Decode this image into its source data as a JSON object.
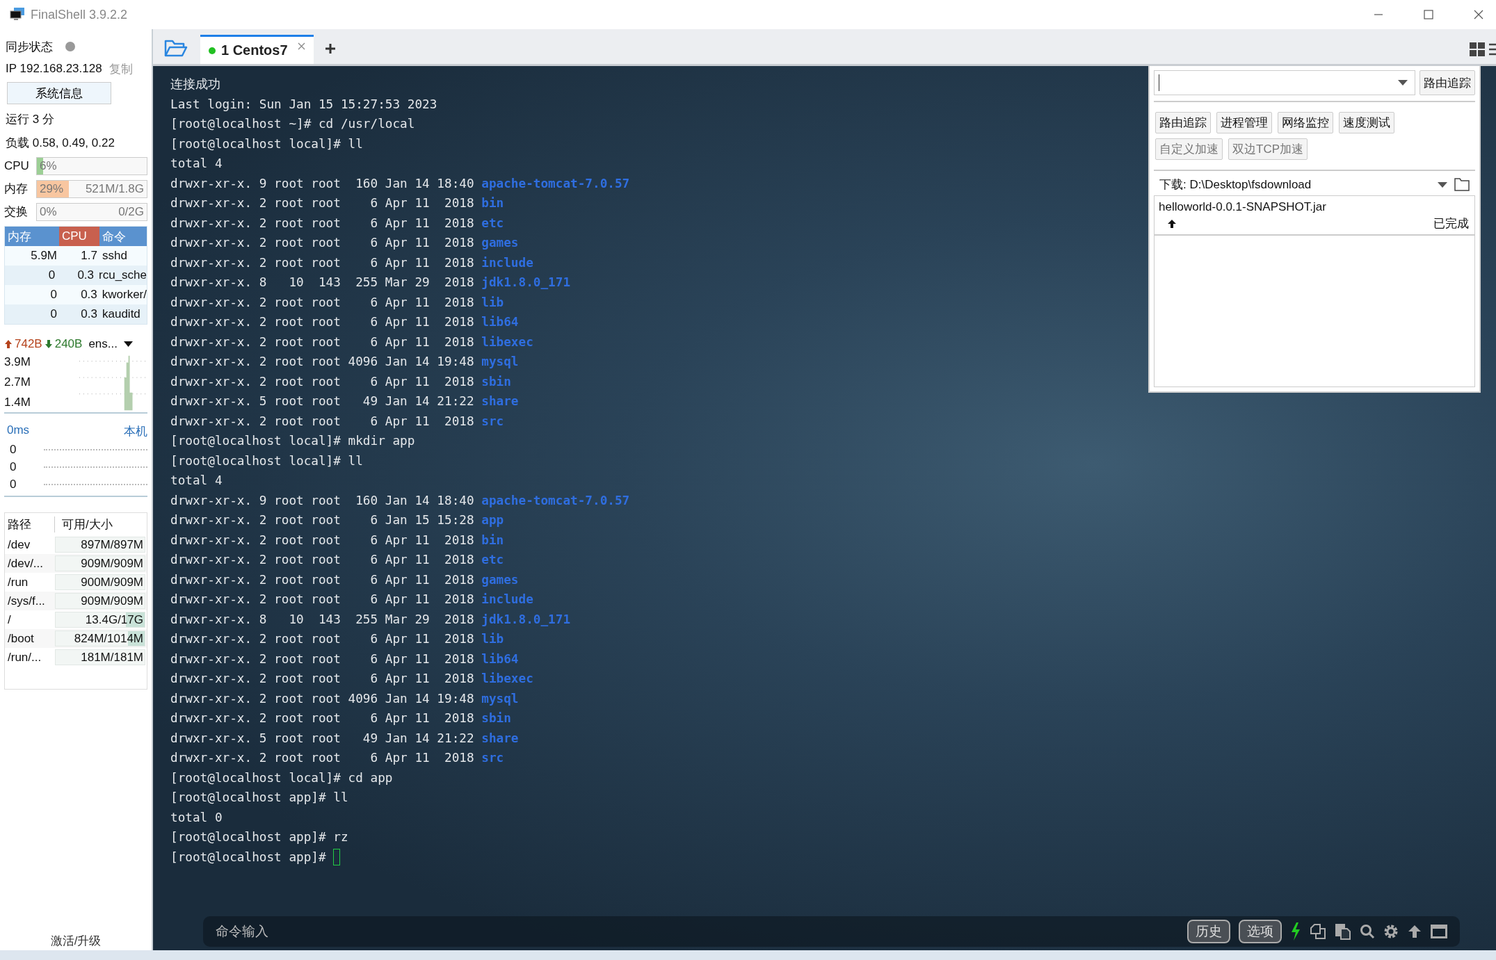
{
  "window": {
    "title": "FinalShell 3.9.2.2"
  },
  "sidebar": {
    "sync": {
      "label": "同步状态",
      "online": false
    },
    "ip": {
      "text": "IP 192.168.23.128",
      "copy": "复制"
    },
    "sysinfo_button": "系统信息",
    "uptime": "运行 3 分",
    "load": "负载 0.58, 0.49, 0.22",
    "meters": [
      {
        "label": "CPU",
        "reading": "6%",
        "level": 0.06,
        "color": "#9ccf95"
      },
      {
        "label": "内存",
        "reading": "29%",
        "detail": "521M/1.8G",
        "level": 0.29,
        "color": "#f8c6a0"
      },
      {
        "label": "交换",
        "reading": "0%",
        "detail": "0/2G",
        "level": 0
      }
    ],
    "processes": {
      "columns": [
        {
          "label": "内存",
          "selected": false
        },
        {
          "label": "CPU",
          "selected": true
        },
        {
          "label": "命令",
          "selected": false
        }
      ],
      "rows": [
        [
          "5.9M",
          "1.7",
          "sshd"
        ],
        [
          "0",
          "0.3",
          "rcu_sche"
        ],
        [
          "0",
          "0.3",
          "kworker/"
        ],
        [
          "0",
          "0.3",
          "kauditd"
        ]
      ]
    },
    "network": {
      "up": "742B",
      "down": "240B",
      "interface": "ens...",
      "scale": [
        "3.9M",
        "2.7M",
        "1.4M"
      ]
    },
    "ping": {
      "latency": "0ms",
      "host": "本机",
      "values": [
        "0",
        "0",
        "0"
      ]
    },
    "disks": {
      "columns": [
        "路径",
        "可用/大小"
      ],
      "rows": [
        {
          "path": "/dev",
          "usage": "897M/897M"
        },
        {
          "path": "/dev/...",
          "usage": "909M/909M"
        },
        {
          "path": "/run",
          "usage": "900M/909M"
        },
        {
          "path": "/sys/f...",
          "usage": "909M/909M"
        },
        {
          "path": "/",
          "usage": "13.4G/17G",
          "level": 0.21
        },
        {
          "path": "/boot",
          "usage": "824M/1014M",
          "level": 0.19
        },
        {
          "path": "/run/...",
          "usage": "181M/181M"
        }
      ]
    },
    "upgrade_link": "激活/升级"
  },
  "tabs": [
    {
      "label": "1 Centos7",
      "selected": true,
      "connected": true
    }
  ],
  "terminal": {
    "lines": [
      {
        "kind": "text",
        "text": "连接成功"
      },
      {
        "kind": "text",
        "text": "Last login: Sun Jan 15 15:27:53 2023"
      },
      {
        "kind": "text",
        "text": "[root@localhost ~]# cd /usr/local"
      },
      {
        "kind": "text",
        "text": "[root@localhost local]# ll"
      },
      {
        "kind": "text",
        "text": "total 4"
      },
      {
        "kind": "entry",
        "text": "drwxr-xr-x. 9 root root  160 Jan 14 18:40",
        "name": "apache-tomcat-7.0.57"
      },
      {
        "kind": "entry",
        "text": "drwxr-xr-x. 2 root root    6 Apr 11  2018",
        "name": "bin"
      },
      {
        "kind": "entry",
        "text": "drwxr-xr-x. 2 root root    6 Apr 11  2018",
        "name": "etc"
      },
      {
        "kind": "entry",
        "text": "drwxr-xr-x. 2 root root    6 Apr 11  2018",
        "name": "games"
      },
      {
        "kind": "entry",
        "text": "drwxr-xr-x. 2 root root    6 Apr 11  2018",
        "name": "include"
      },
      {
        "kind": "entry",
        "text": "drwxr-xr-x. 8   10  143  255 Mar 29  2018",
        "name": "jdk1.8.0_171"
      },
      {
        "kind": "entry",
        "text": "drwxr-xr-x. 2 root root    6 Apr 11  2018",
        "name": "lib"
      },
      {
        "kind": "entry",
        "text": "drwxr-xr-x. 2 root root    6 Apr 11  2018",
        "name": "lib64"
      },
      {
        "kind": "entry",
        "text": "drwxr-xr-x. 2 root root    6 Apr 11  2018",
        "name": "libexec"
      },
      {
        "kind": "entry",
        "text": "drwxr-xr-x. 2 root root 4096 Jan 14 19:48",
        "name": "mysql"
      },
      {
        "kind": "entry",
        "text": "drwxr-xr-x. 2 root root    6 Apr 11  2018",
        "name": "sbin"
      },
      {
        "kind": "entry",
        "text": "drwxr-xr-x. 5 root root   49 Jan 14 21:22",
        "name": "share"
      },
      {
        "kind": "entry",
        "text": "drwxr-xr-x. 2 root root    6 Apr 11  2018",
        "name": "src"
      },
      {
        "kind": "text",
        "text": "[root@localhost local]# mkdir app"
      },
      {
        "kind": "text",
        "text": "[root@localhost local]# ll"
      },
      {
        "kind": "text",
        "text": "total 4"
      },
      {
        "kind": "entry",
        "text": "drwxr-xr-x. 9 root root  160 Jan 14 18:40",
        "name": "apache-tomcat-7.0.57"
      },
      {
        "kind": "entry",
        "text": "drwxr-xr-x. 2 root root    6 Jan 15 15:28",
        "name": "app"
      },
      {
        "kind": "entry",
        "text": "drwxr-xr-x. 2 root root    6 Apr 11  2018",
        "name": "bin"
      },
      {
        "kind": "entry",
        "text": "drwxr-xr-x. 2 root root    6 Apr 11  2018",
        "name": "etc"
      },
      {
        "kind": "entry",
        "text": "drwxr-xr-x. 2 root root    6 Apr 11  2018",
        "name": "games"
      },
      {
        "kind": "entry",
        "text": "drwxr-xr-x. 2 root root    6 Apr 11  2018",
        "name": "include"
      },
      {
        "kind": "entry",
        "text": "drwxr-xr-x. 8   10  143  255 Mar 29  2018",
        "name": "jdk1.8.0_171"
      },
      {
        "kind": "entry",
        "text": "drwxr-xr-x. 2 root root    6 Apr 11  2018",
        "name": "lib"
      },
      {
        "kind": "entry",
        "text": "drwxr-xr-x. 2 root root    6 Apr 11  2018",
        "name": "lib64"
      },
      {
        "kind": "entry",
        "text": "drwxr-xr-x. 2 root root    6 Apr 11  2018",
        "name": "libexec"
      },
      {
        "kind": "entry",
        "text": "drwxr-xr-x. 2 root root 4096 Jan 14 19:48",
        "name": "mysql"
      },
      {
        "kind": "entry",
        "text": "drwxr-xr-x. 2 root root    6 Apr 11  2018",
        "name": "sbin"
      },
      {
        "kind": "entry",
        "text": "drwxr-xr-x. 5 root root   49 Jan 14 21:22",
        "name": "share"
      },
      {
        "kind": "entry",
        "text": "drwxr-xr-x. 2 root root    6 Apr 11  2018",
        "name": "src"
      },
      {
        "kind": "text",
        "text": "[root@localhost local]# cd app"
      },
      {
        "kind": "text",
        "text": "[root@localhost app]# ll"
      },
      {
        "kind": "text",
        "text": "total 0"
      },
      {
        "kind": "text",
        "text": "[root@localhost app]# rz"
      },
      {
        "kind": "prompt",
        "text": "[root@localhost app]#",
        "cursor": true
      }
    ]
  },
  "tools_panel": {
    "route_button": "路由追踪",
    "tools": [
      {
        "label": "路由追踪",
        "disabled": false
      },
      {
        "label": "进程管理",
        "disabled": false
      },
      {
        "label": "网络监控",
        "disabled": false
      },
      {
        "label": "速度测试",
        "disabled": false
      },
      {
        "label": "自定义加速",
        "disabled": true
      },
      {
        "label": "双边TCP加速",
        "disabled": true
      }
    ],
    "download_path": "下载: D:\\Desktop\\fsdownload",
    "transfers": [
      {
        "file": "helloworld-0.0.1-SNAPSHOT.jar",
        "kind": "upload",
        "status": "已完成"
      }
    ]
  },
  "command_bar": {
    "placeholder": "命令输入",
    "buttons": [
      "历史",
      "选项"
    ]
  }
}
